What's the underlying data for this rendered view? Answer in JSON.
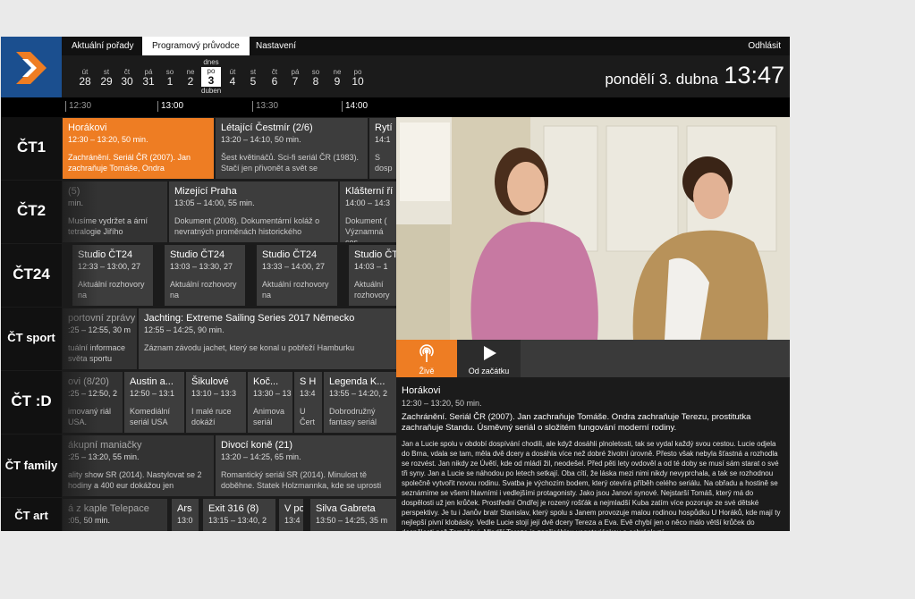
{
  "nav": {
    "tabs": [
      {
        "label": "Aktuální pořady"
      },
      {
        "label": "Programový průvodce"
      },
      {
        "label": "Nastavení"
      }
    ],
    "logout": "Odhlásit"
  },
  "dates": {
    "days": [
      {
        "dn": "út",
        "num": "28"
      },
      {
        "dn": "st",
        "num": "29"
      },
      {
        "dn": "čt",
        "num": "30"
      },
      {
        "dn": "pá",
        "num": "31"
      },
      {
        "dn": "so",
        "num": "1"
      },
      {
        "dn": "ne",
        "num": "2"
      },
      {
        "dn": "po",
        "num": "3",
        "top": "dnes",
        "bottom": "duben"
      },
      {
        "dn": "út",
        "num": "4"
      },
      {
        "dn": "st",
        "num": "5"
      },
      {
        "dn": "čt",
        "num": "6"
      },
      {
        "dn": "pá",
        "num": "7"
      },
      {
        "dn": "so",
        "num": "8"
      },
      {
        "dn": "ne",
        "num": "9"
      },
      {
        "dn": "po",
        "num": "10"
      }
    ],
    "current_date": "pondělí 3. dubna",
    "current_time": "13:47"
  },
  "timeline": [
    "12:30",
    "13:00",
    "13:30",
    "14:00"
  ],
  "channels": [
    {
      "name": "ČT1",
      "programs": [
        {
          "title": "Horákovi",
          "time": "12:30 – 13:20, 50 min.",
          "desc": "Zachránění. Seriál ČR (2007). Jan zachraňuje Tomáše, Ondra"
        },
        {
          "title": "Létající Čestmír (2/6)",
          "time": "13:20 – 14:10, 50 min.",
          "desc": "Šest květináčů. Sci-fi seriál ČR (1983). Stačí jen přivonět a svět se"
        },
        {
          "title": "Rytí",
          "time": "14:1",
          "desc": "S dosp"
        }
      ]
    },
    {
      "name": "ČT2",
      "programs": [
        {
          "title": "(5)",
          "time": "min.",
          "desc": "Musíme vydržet a ární tetralogie Jiřího"
        },
        {
          "title": "Mizející Praha",
          "time": "13:05 – 14:00, 55 min.",
          "desc": "Dokument (2008). Dokumentární koláž o nevratných proměnách historického"
        },
        {
          "title": "Klášterní ří",
          "time": "14:00 – 14:3",
          "desc": "Dokument ( Významná ces"
        }
      ]
    },
    {
      "name": "ČT24",
      "programs": [
        {
          "title": "Studio ČT24",
          "time": "12:33 – 13:00, 27",
          "desc": "Aktuální rozhovory na"
        },
        {
          "title": "Studio ČT24",
          "time": "13:03 – 13:30, 27",
          "desc": "Aktuální rozhovory na"
        },
        {
          "title": "Studio ČT24",
          "time": "13:33 – 14:00, 27",
          "desc": "Aktuální rozhovory na"
        },
        {
          "title": "Studio ČT",
          "time": "14:03 – 1",
          "desc": "Aktuální rozhovory"
        }
      ]
    },
    {
      "name": "ČT sport",
      "programs": [
        {
          "title": "portovní zprávy",
          "time": ":25 – 12:55, 30 m",
          "desc": "tuální informace světa sportu"
        },
        {
          "title": "Jachting: Extreme Sailing Series 2017 Německo",
          "time": "12:55 – 14:25, 90 min.",
          "desc": "Záznam závodu jachet, který se konal u pobřeží Hamburku"
        }
      ]
    },
    {
      "name": "ČT :D",
      "programs": [
        {
          "title": "ovi (8/20)",
          "time": ":25 – 12:50, 2",
          "desc": "imovaný riál USA."
        },
        {
          "title": "Austin a...",
          "time": "12:50 – 13:1",
          "desc": "Komediální seriál USA"
        },
        {
          "title": "Šikulové",
          "time": "13:10 – 13:3",
          "desc": "I malé ruce dokáží"
        },
        {
          "title": "Koč...",
          "time": "13:30 – 13",
          "desc": "Animova seriál"
        },
        {
          "title": "S H",
          "time": "13:4",
          "desc": "U Čert"
        },
        {
          "title": "Legenda K...",
          "time": "13:55 – 14:20, 2",
          "desc": "Dobrodružný fantasy seriál"
        }
      ]
    },
    {
      "name": "ČT family",
      "programs": [
        {
          "title": "ákupní maniačky",
          "time": ":25 – 13:20, 55 min.",
          "desc": "ality show SR (2014). Nastylovat se 2 hodiny a 400 eur dokážou jen"
        },
        {
          "title": "Divocí koně (21)",
          "time": "13:20 – 14:25, 65 min.",
          "desc": "Romantický seriál SR (2014). Minulost tě doběhne. Statek Holzmannka, kde se uprosti"
        }
      ]
    },
    {
      "name": "ČT art",
      "programs": [
        {
          "title": "á z kaple Telepace",
          "time": ":05, 50 min.",
          "desc": ""
        },
        {
          "title": "Ars",
          "time": "13:0",
          "desc": ""
        },
        {
          "title": "Exit 316 (8)",
          "time": "13:15 – 13:40, 2",
          "desc": ""
        },
        {
          "title": "V po",
          "time": "13:4",
          "desc": ""
        },
        {
          "title": "Silva Gabreta",
          "time": "13:50 – 14:25, 35 m",
          "desc": ""
        }
      ]
    }
  ],
  "player": {
    "live_label": "Živě",
    "start_label": "Od začátku"
  },
  "details": {
    "title": "Horákovi",
    "time": "12:30 – 13:20, 50 min.",
    "short": "Zachránění. Seriál ČR (2007). Jan zachraňuje Tomáše. Ondra zachraňuje Terezu, prostitutka zachraňuje Standu. Úsměvný seriál o složitém fungování moderní rodiny.",
    "long": "Jan a Lucie spolu v období dospívání chodili, ale když dosáhli plnoletosti, tak se vydal každý svou cestou. Lucie odjela do Brna, vdala se tam, měla dvě dcery a dosáhla více než dobré životní úrovně. Přesto však nebyla šťastná a rozhodla se rozvést. Jan nikdy ze Úvětí, kde od mládí žil, neodešel. Před pěti lety ovdověl a od té doby se musí sám starat o své tři syny. Jan a Lucie se náhodou po letech setkají. Oba cítí, že láska mezi nimi nikdy nevyprchala, a tak se rozhodnou společně vytvořit novou rodinu. Svatba je výchozím bodem, který otevírá příběh celého seriálu. Na obřadu a hostině se seznámíme se všemi hlavními i vedlejšími protagonisty. Jako jsou Janovi synové. Nejstarší Tomáš, který má do dospělosti už jen krůček. Prostřední Ondřej je rozený rošťák a nejmladší Kuba zatím více pozoruje ze své dětské perspektivy. Je tu i Janův bratr Stanislav, který spolu s Janem provozuje malou rodinou hospůdku U Horáků, kde mají ty nejlepší pivní klobásky. Vedle Lucie stojí její dvě dcery Tereza a Eva. Evě chybí jen o něco málo větší krůček do dospělosti než Tomášovi. Mladší Tereza je zapřisáhlou vegetariánkou a ochránkyní"
  },
  "colors": {
    "accent": "#ee7d23",
    "logo_bg": "#1b4f8f",
    "background": "#1b1b1b"
  }
}
